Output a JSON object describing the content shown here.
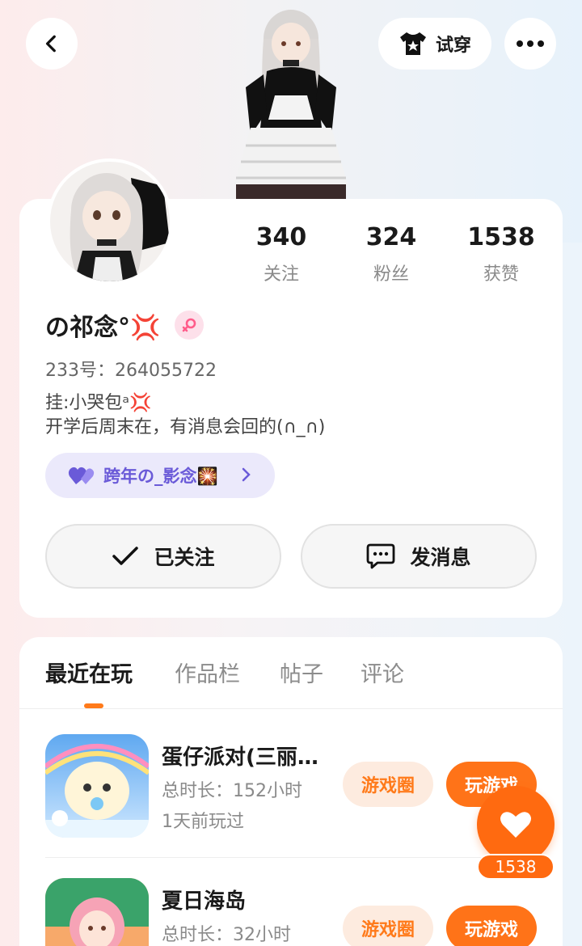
{
  "header": {
    "tryon_label": "试穿",
    "icons": {
      "back": "back-arrow-icon",
      "tryon": "tshirt-star-icon",
      "more": "more-dots-icon"
    }
  },
  "profile": {
    "stats": [
      {
        "num": "340",
        "label": "关注"
      },
      {
        "num": "324",
        "label": "粉丝"
      },
      {
        "num": "1538",
        "label": "获赞"
      }
    ],
    "nickname": "の祁念°💢",
    "gender_icon": "female-icon",
    "uid": "233号：264055722",
    "bio_line1": "挂:小哭包ᵃ💢",
    "bio_line2": "开学后周末在，有消息会回的(∩_∩)",
    "cp_label": "跨年の_影念🎇",
    "follow_label": "已关注",
    "message_label": "发消息"
  },
  "tabs": [
    "最近在玩",
    "作品栏",
    "帖子",
    "评论"
  ],
  "games": [
    {
      "name": "蛋仔派对(三丽…",
      "time": "总时长：152小时",
      "last": "1天前玩过",
      "circle": "游戏圈",
      "play": "玩游戏"
    },
    {
      "name": "夏日海岛",
      "time": "总时长：32小时",
      "last": "",
      "circle": "游戏圈",
      "play": "玩游戏"
    }
  ],
  "like_fab": {
    "count": "1538"
  },
  "colors": {
    "accent": "#ff7318",
    "accent_light": "#fdebdf",
    "cp_text": "#6a5ad8"
  }
}
